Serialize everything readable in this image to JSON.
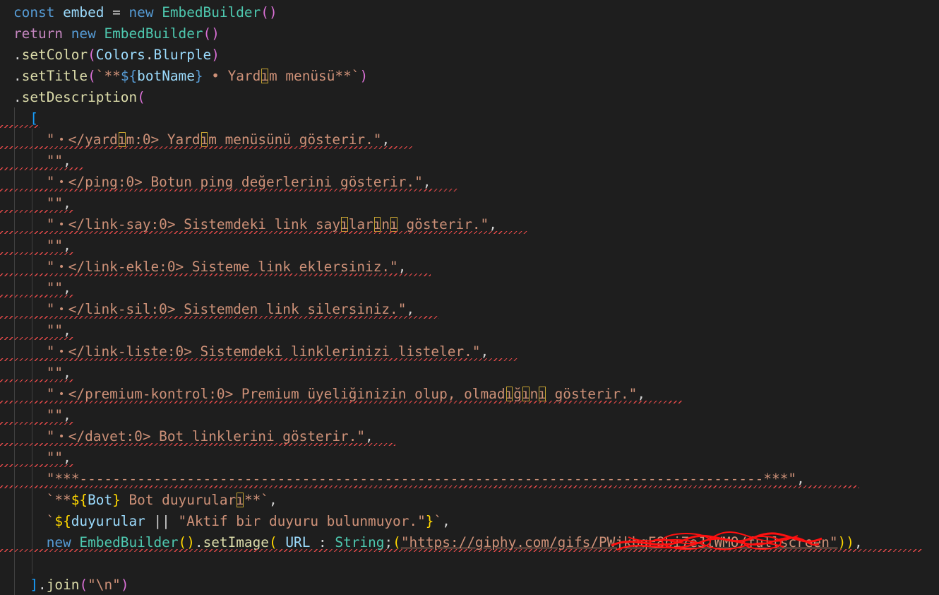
{
  "editor": {
    "colors": {
      "background": "#1e1e1e",
      "keyword": "#569cd6",
      "control": "#c586c0",
      "variable": "#9cdcfe",
      "class": "#4ec9b0",
      "function": "#dcdcaa",
      "string": "#ce9178",
      "bracket_1": "#ffd700",
      "bracket_2": "#da70d6",
      "bracket_3": "#179fff",
      "error_squiggle": "#f14c4c",
      "unicode_highlight": "#c5a332",
      "redaction_scribble": "#ff1010"
    },
    "lines": [
      {
        "tokens": [
          {
            "t": "kw",
            "v": "const"
          },
          {
            "t": "txt",
            "v": " "
          },
          {
            "t": "var",
            "v": "embed"
          },
          {
            "t": "txt",
            "v": " = "
          },
          {
            "t": "kw",
            "v": "new"
          },
          {
            "t": "txt",
            "v": " "
          },
          {
            "t": "cls",
            "v": "EmbedBuilder"
          },
          {
            "t": "p2",
            "v": "()"
          }
        ]
      },
      {
        "tokens": [
          {
            "t": "ctl",
            "v": "return"
          },
          {
            "t": "txt",
            "v": " "
          },
          {
            "t": "kw",
            "v": "new"
          },
          {
            "t": "txt",
            "v": " "
          },
          {
            "t": "cls",
            "v": "EmbedBuilder"
          },
          {
            "t": "p2",
            "v": "()"
          }
        ]
      },
      {
        "tokens": [
          {
            "t": "txt",
            "v": "."
          },
          {
            "t": "fn",
            "v": "setColor"
          },
          {
            "t": "p2",
            "v": "("
          },
          {
            "t": "var",
            "v": "Colors"
          },
          {
            "t": "txt",
            "v": "."
          },
          {
            "t": "var",
            "v": "Blurple"
          },
          {
            "t": "p2",
            "v": ")"
          }
        ]
      },
      {
        "tokens": [
          {
            "t": "txt",
            "v": "."
          },
          {
            "t": "fn",
            "v": "setTitle"
          },
          {
            "t": "p2",
            "v": "("
          },
          {
            "t": "str",
            "v": "`**"
          },
          {
            "t": "kw",
            "v": "${"
          },
          {
            "t": "var",
            "v": "botName"
          },
          {
            "t": "kw",
            "v": "}"
          },
          {
            "t": "str",
            "v": " • Yard"
          },
          {
            "t": "box",
            "v": "ı"
          },
          {
            "t": "str",
            "v": "m menüsü**`"
          },
          {
            "t": "p2",
            "v": ")"
          }
        ]
      },
      {
        "tokens": [
          {
            "t": "txt",
            "v": "."
          },
          {
            "t": "fn",
            "v": "setDescription"
          },
          {
            "t": "p2",
            "v": "("
          }
        ]
      },
      {
        "tokens": [
          {
            "t": "txt",
            "v": "  "
          },
          {
            "t": "p3",
            "v": "["
          }
        ],
        "squiggle": 56
      },
      {
        "tokens": [
          {
            "t": "txt",
            "v": "    "
          },
          {
            "t": "str",
            "v": "\"・</yard"
          },
          {
            "t": "box",
            "v": "ı"
          },
          {
            "t": "str",
            "v": "m:0> Yard"
          },
          {
            "t": "box",
            "v": "ı"
          },
          {
            "t": "str",
            "v": "m menüsünü gösterir.\""
          },
          {
            "t": "txt",
            "v": ","
          }
        ],
        "squiggle": 586
      },
      {
        "tokens": [
          {
            "t": "txt",
            "v": "    "
          },
          {
            "t": "str",
            "v": "\"\""
          },
          {
            "t": "txt",
            "v": ","
          }
        ],
        "squiggle": 118
      },
      {
        "tokens": [
          {
            "t": "txt",
            "v": "    "
          },
          {
            "t": "str",
            "v": "\"・</ping:0> Botun ping değerlerini gösterir.\""
          },
          {
            "t": "txt",
            "v": ","
          }
        ],
        "squiggle": 648
      },
      {
        "tokens": [
          {
            "t": "txt",
            "v": "    "
          },
          {
            "t": "str",
            "v": "\"\""
          },
          {
            "t": "txt",
            "v": ","
          }
        ],
        "squiggle": 104
      },
      {
        "tokens": [
          {
            "t": "txt",
            "v": "    "
          },
          {
            "t": "str",
            "v": "\"・</link-say:0> Sistemdeki link say"
          },
          {
            "t": "box",
            "v": "ı"
          },
          {
            "t": "str",
            "v": "lar"
          },
          {
            "t": "box",
            "v": "ı"
          },
          {
            "t": "str",
            "v": "n"
          },
          {
            "t": "box",
            "v": "ı"
          },
          {
            "t": "str",
            "v": " gösterir.\""
          },
          {
            "t": "txt",
            "v": ","
          }
        ],
        "squiggle": 747
      },
      {
        "tokens": [
          {
            "t": "txt",
            "v": "    "
          },
          {
            "t": "str",
            "v": "\"\""
          },
          {
            "t": "txt",
            "v": ","
          }
        ],
        "squiggle": 104
      },
      {
        "tokens": [
          {
            "t": "txt",
            "v": "    "
          },
          {
            "t": "str",
            "v": "\"・</link-ekle:0> Sisteme link eklersiniz.\""
          },
          {
            "t": "txt",
            "v": ","
          }
        ],
        "squiggle": 610
      },
      {
        "tokens": [
          {
            "t": "txt",
            "v": "    "
          },
          {
            "t": "str",
            "v": "\"\""
          },
          {
            "t": "txt",
            "v": ","
          }
        ],
        "squiggle": 104
      },
      {
        "tokens": [
          {
            "t": "txt",
            "v": "    "
          },
          {
            "t": "str",
            "v": "\"・</link-sil:0> Sistemden link silersiniz.\""
          },
          {
            "t": "txt",
            "v": ","
          }
        ],
        "squiggle": 622
      },
      {
        "tokens": [
          {
            "t": "txt",
            "v": "    "
          },
          {
            "t": "str",
            "v": "\"\""
          },
          {
            "t": "txt",
            "v": ","
          }
        ],
        "squiggle": 104
      },
      {
        "tokens": [
          {
            "t": "txt",
            "v": "    "
          },
          {
            "t": "str",
            "v": "\"・</link-liste:0> Sistemdeki linklerinizi listeler.\""
          },
          {
            "t": "txt",
            "v": ","
          }
        ],
        "squiggle": 734
      },
      {
        "tokens": [
          {
            "t": "txt",
            "v": "    "
          },
          {
            "t": "str",
            "v": "\"\""
          },
          {
            "t": "txt",
            "v": ","
          }
        ],
        "squiggle": 104
      },
      {
        "tokens": [
          {
            "t": "txt",
            "v": "    "
          },
          {
            "t": "str",
            "v": "\"・</premium-kontrol:0> Premium üyeliğinizin olup, olmad"
          },
          {
            "t": "box",
            "v": "ı"
          },
          {
            "t": "str",
            "v": "ğ"
          },
          {
            "t": "box",
            "v": "ı"
          },
          {
            "t": "str",
            "v": "n"
          },
          {
            "t": "box",
            "v": "ı"
          },
          {
            "t": "str",
            "v": " gösterir.\""
          },
          {
            "t": "txt",
            "v": ","
          }
        ],
        "squiggle": 968
      },
      {
        "tokens": [
          {
            "t": "txt",
            "v": "    "
          },
          {
            "t": "str",
            "v": "\"\""
          },
          {
            "t": "txt",
            "v": ","
          }
        ],
        "squiggle": 104
      },
      {
        "tokens": [
          {
            "t": "txt",
            "v": "    "
          },
          {
            "t": "str",
            "v": "\"・</davet:0> Bot linklerini gösterir.\""
          },
          {
            "t": "txt",
            "v": ","
          }
        ],
        "squiggle": 560
      },
      {
        "tokens": [
          {
            "t": "txt",
            "v": "    "
          },
          {
            "t": "str",
            "v": "\"\""
          },
          {
            "t": "txt",
            "v": ","
          }
        ],
        "squiggle": 104
      },
      {
        "tokens": [
          {
            "t": "txt",
            "v": "    "
          },
          {
            "t": "str",
            "v": "\"***-----------------------------------------------------------------------------------***\""
          },
          {
            "t": "txt",
            "v": ","
          }
        ],
        "squiggle": 1217
      },
      {
        "tokens": [
          {
            "t": "txt",
            "v": "    "
          },
          {
            "t": "str",
            "v": "`**"
          },
          {
            "t": "p1",
            "v": "${"
          },
          {
            "t": "var",
            "v": "Bot"
          },
          {
            "t": "p1",
            "v": "}"
          },
          {
            "t": "str",
            "v": " Bot duyurular"
          },
          {
            "t": "box",
            "v": "ı"
          },
          {
            "t": "str",
            "v": "**`"
          },
          {
            "t": "txt",
            "v": ","
          }
        ]
      },
      {
        "tokens": [
          {
            "t": "txt",
            "v": "    "
          },
          {
            "t": "str",
            "v": "`"
          },
          {
            "t": "p1",
            "v": "${"
          },
          {
            "t": "var",
            "v": "duyurular"
          },
          {
            "t": "txt",
            "v": " || "
          },
          {
            "t": "str",
            "v": "\"Aktif bir duyuru bulunmuyor.\""
          },
          {
            "t": "p1",
            "v": "}"
          },
          {
            "t": "str",
            "v": "`"
          },
          {
            "t": "txt",
            "v": ","
          }
        ]
      },
      {
        "tokens": [
          {
            "t": "txt",
            "v": "    "
          },
          {
            "t": "kw",
            "v": "new"
          },
          {
            "t": "txt",
            "v": " "
          },
          {
            "t": "cls",
            "v": "EmbedBuilder"
          },
          {
            "t": "p1",
            "v": "()"
          },
          {
            "t": "txt",
            "v": "."
          },
          {
            "t": "fn",
            "v": "setImage"
          },
          {
            "t": "p1",
            "v": "("
          },
          {
            "t": "txt",
            "v": " "
          },
          {
            "t": "var",
            "v": "URL"
          },
          {
            "t": "txt",
            "v": " : "
          },
          {
            "t": "cls",
            "v": "String"
          },
          {
            "t": "txt",
            "v": ";"
          },
          {
            "t": "p1",
            "v": "("
          },
          {
            "t": "url",
            "v": "\"https://giphy.com/gifs/PWjkbqE8bi7eJiWMO/fullscreen\""
          },
          {
            "t": "p1",
            "v": ")"
          },
          {
            "t": "p1",
            "v": ")"
          },
          {
            "t": "txt",
            "v": ","
          }
        ],
        "squiggle": 1306
      },
      {
        "tokens": []
      },
      {
        "tokens": [
          {
            "t": "txt",
            "v": "  "
          },
          {
            "t": "p3",
            "v": "]"
          },
          {
            "t": "txt",
            "v": "."
          },
          {
            "t": "fn",
            "v": "join"
          },
          {
            "t": "p2",
            "v": "("
          },
          {
            "t": "str",
            "v": "\"\\n\""
          },
          {
            "t": "p2",
            "v": ")"
          }
        ]
      }
    ]
  }
}
